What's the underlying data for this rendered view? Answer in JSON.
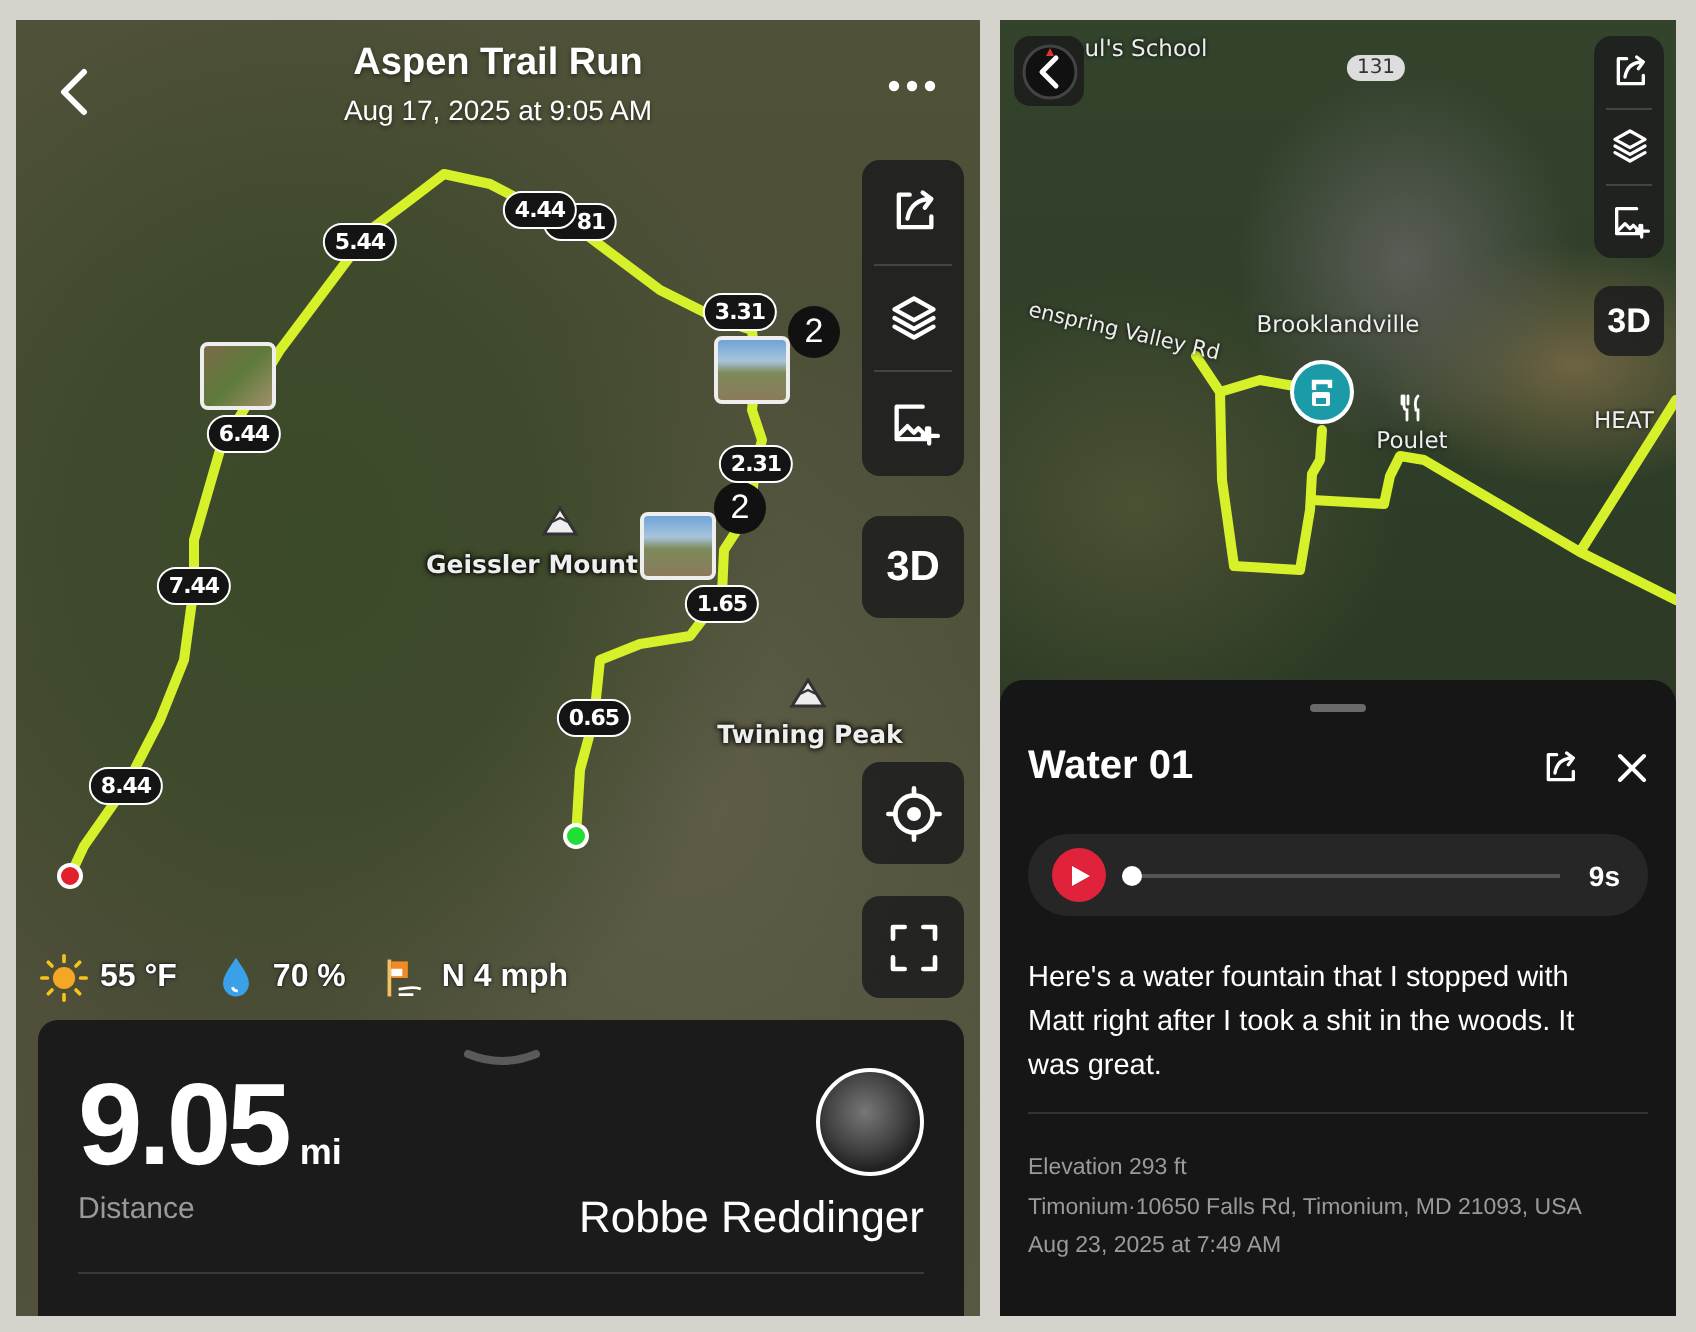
{
  "activity": {
    "title": "Aspen Trail Run",
    "subtitle": "Aug 17, 2025 at 9:05 AM"
  },
  "map": {
    "mile_markers": [
      {
        "label": "5.44"
      },
      {
        "label": "4.44"
      },
      {
        "label": "81"
      },
      {
        "label": "3.31"
      },
      {
        "label": "6.44"
      },
      {
        "label": "2.31"
      },
      {
        "label": "7.44"
      },
      {
        "label": "1.65"
      },
      {
        "label": "0.65"
      },
      {
        "label": "8.44"
      }
    ],
    "photo_markers": [
      {
        "kind": "group",
        "count": "2"
      },
      {
        "kind": "group",
        "count": "2"
      },
      {
        "kind": "single"
      }
    ],
    "places": [
      {
        "label": "Geissler Mount"
      },
      {
        "label": "Twining Peak"
      }
    ]
  },
  "map_controls": [
    {
      "kind": "share"
    },
    {
      "kind": "layers"
    },
    {
      "kind": "add_photo"
    },
    {
      "kind": "perspective",
      "label": "3D"
    },
    {
      "kind": "locate"
    },
    {
      "kind": "fullscreen"
    }
  ],
  "weather": [
    {
      "kind": "sun",
      "text": "55 °F"
    },
    {
      "kind": "drop",
      "text": "70 %"
    },
    {
      "kind": "wind",
      "text": "N 4 mph"
    }
  ],
  "summary": {
    "distance": "9.05",
    "unit": "mi",
    "distance_label": "Distance",
    "athlete": "Robbe Reddinger"
  },
  "detail_map": {
    "labels": [
      {
        "kind": "place",
        "text": "ul's School"
      },
      {
        "kind": "road_badge",
        "text": "131"
      },
      {
        "kind": "road",
        "text": "enspring Valley Rd"
      },
      {
        "kind": "place",
        "text": "Brooklandville"
      },
      {
        "kind": "restaurant",
        "text": "Poulet"
      },
      {
        "kind": "place",
        "text": "HEAT"
      }
    ],
    "controls": [
      {
        "kind": "share"
      },
      {
        "kind": "layers"
      },
      {
        "kind": "add_photo"
      },
      {
        "kind": "perspective",
        "label": "3D"
      }
    ]
  },
  "waypoint": {
    "title": "Water 01",
    "audio": {
      "level": 0,
      "duration": "9s"
    },
    "note": "Here's a water fountain that I stopped with Matt right after I took a shit in the woods. It was great.",
    "elevation": "Elevation 293 ft",
    "address": "Timonium·10650 Falls Rd, Timonium, MD 21093, USA",
    "time": "Aug 23, 2025 at 7:49 AM"
  }
}
